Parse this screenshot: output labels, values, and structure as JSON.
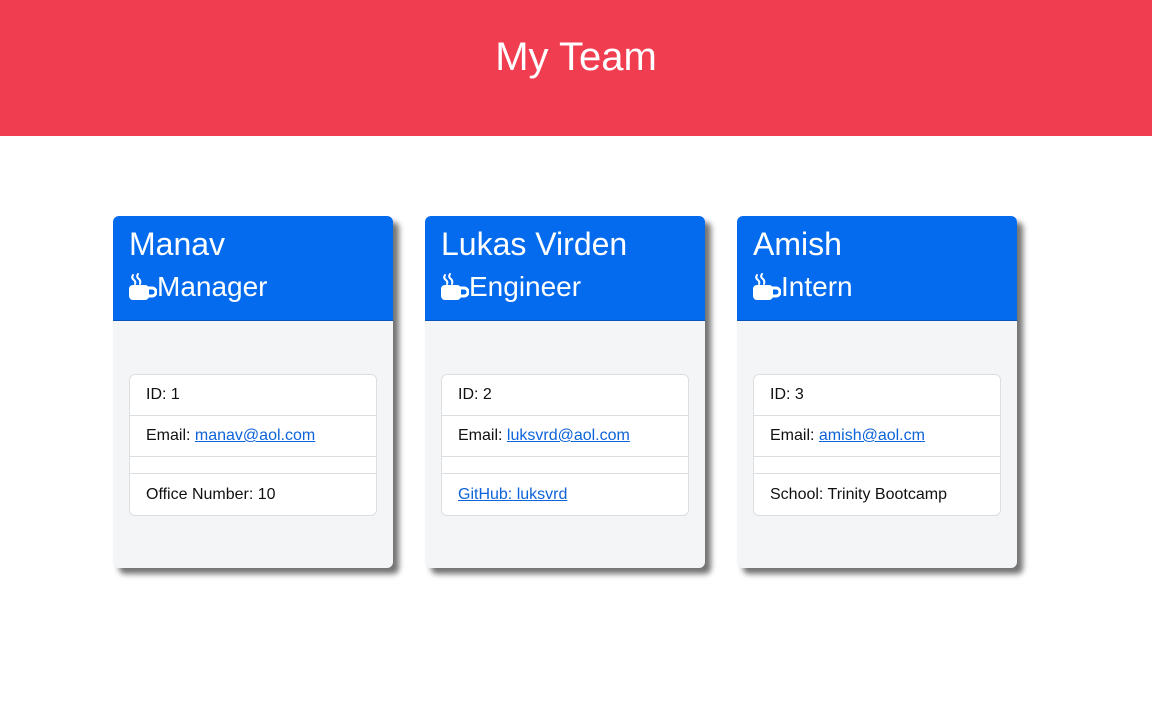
{
  "header": {
    "title": "My Team"
  },
  "colors": {
    "header_bg": "#f03e50",
    "card_header_bg": "#056bee",
    "link": "#0d63d9"
  },
  "cards": [
    {
      "name": "Manav",
      "role_icon": "mug-hot-icon",
      "role": "Manager",
      "id_text": "ID: 1",
      "email_label": "Email: ",
      "email": "manav@aol.com",
      "extra_kind": "text",
      "extra": "Office Number: 10"
    },
    {
      "name": "Lukas Virden",
      "role_icon": "mug-hot-icon",
      "role": "Engineer",
      "id_text": "ID: 2",
      "email_label": "Email: ",
      "email": "luksvrd@aol.com",
      "extra_kind": "link",
      "extra": "GitHub: luksvrd"
    },
    {
      "name": "Amish",
      "role_icon": "mug-hot-icon",
      "role": "Intern",
      "id_text": "ID: 3",
      "email_label": "Email: ",
      "email": "amish@aol.cm",
      "extra_kind": "text",
      "extra": "School: Trinity Bootcamp"
    }
  ]
}
